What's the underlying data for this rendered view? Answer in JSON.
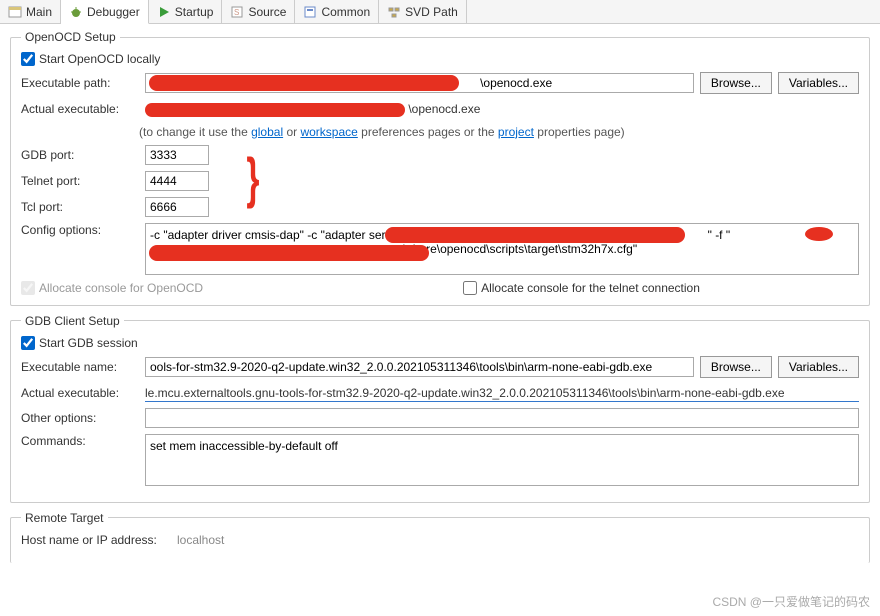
{
  "tabs": {
    "main": "Main",
    "debugger": "Debugger",
    "startup": "Startup",
    "source": "Source",
    "common": "Common",
    "svd": "SVD Path"
  },
  "openocd": {
    "legend": "OpenOCD Setup",
    "start_locally": "Start OpenOCD locally",
    "exec_path_label": "Executable path:",
    "exec_path_value": "                                                                                                   \\openocd.exe",
    "actual_exec_label": "Actual executable:",
    "actual_exec_value": "                                                                              \\openocd.exe",
    "hint_prefix": "(to change it use the ",
    "hint_global": "global",
    "hint_or": " or ",
    "hint_workspace": "workspace",
    "hint_mid": " preferences pages or the ",
    "hint_project": "project",
    "hint_suffix": " properties page)",
    "gdb_port_label": "GDB port:",
    "gdb_port": "3333",
    "telnet_port_label": "Telnet port:",
    "telnet_port": "4444",
    "tcl_port_label": "Tcl port:",
    "tcl_port": "6666",
    "config_label": "Config options:",
    "config_value": "-c \"adapter driver cmsis-dap\" -c \"adapter serial                                                                                             \" -f \"\n                                                                            \\share\\openocd\\scripts\\target\\stm32h7x.cfg\"",
    "alloc_console": "Allocate console for OpenOCD",
    "alloc_telnet": "Allocate console for the telnet connection"
  },
  "gdb": {
    "legend": "GDB Client Setup",
    "start_session": "Start GDB session",
    "exec_name_label": "Executable name:",
    "exec_name_value": "ools-for-stm32.9-2020-q2-update.win32_2.0.0.202105311346\\tools\\bin\\arm-none-eabi-gdb.exe",
    "actual_exec_label": "Actual executable:",
    "actual_exec_value": "le.mcu.externaltools.gnu-tools-for-stm32.9-2020-q2-update.win32_2.0.0.202105311346\\tools\\bin\\arm-none-eabi-gdb.exe",
    "other_label": "Other options:",
    "other_value": "",
    "commands_label": "Commands:",
    "commands_value": "set mem inaccessible-by-default off"
  },
  "remote": {
    "legend": "Remote Target",
    "host_label": "Host name or IP address:",
    "host_value": "localhost"
  },
  "buttons": {
    "browse": "Browse...",
    "variables": "Variables..."
  },
  "watermark": "CSDN @一只爱做笔记的码农"
}
